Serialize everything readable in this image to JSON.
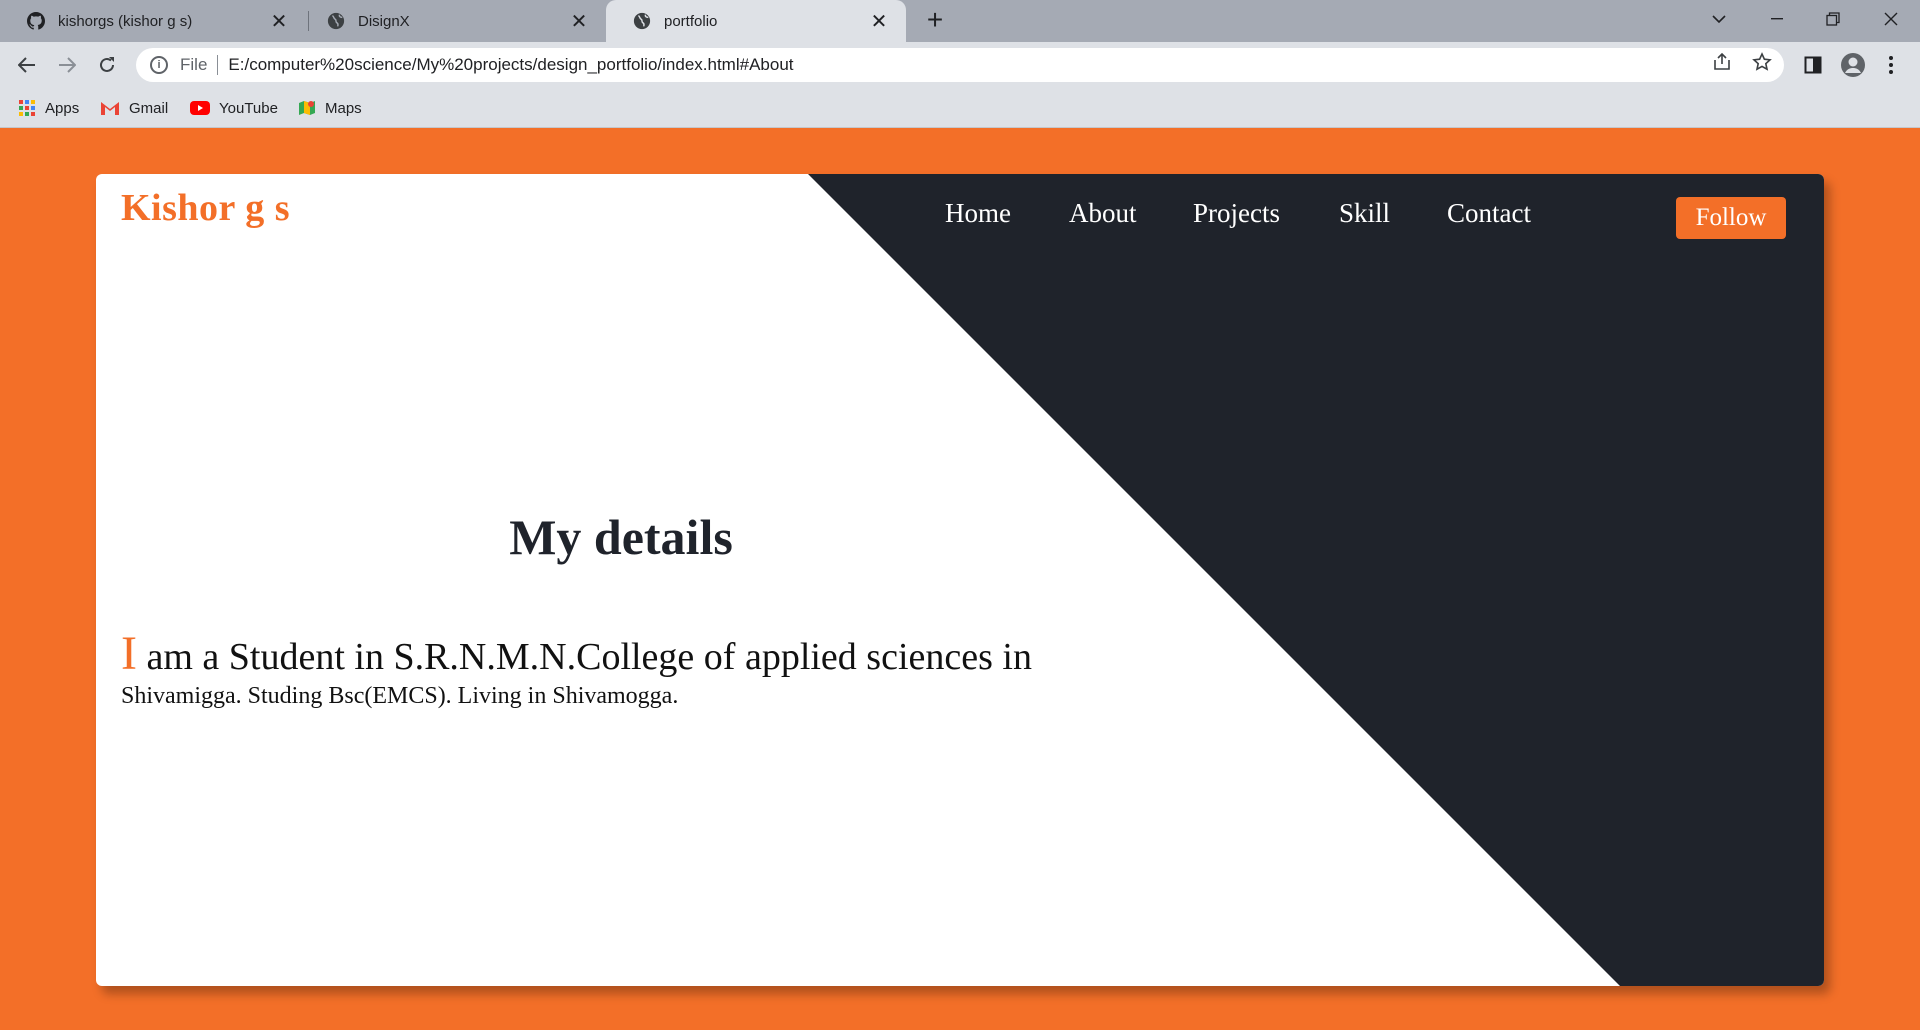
{
  "tabs": [
    {
      "title": "kishorgs (kishor g s)",
      "icon": "github-icon",
      "active": false
    },
    {
      "title": "DisignX",
      "icon": "globe-icon",
      "active": false
    },
    {
      "title": "portfolio",
      "icon": "globe-icon",
      "active": true
    }
  ],
  "address_bar": {
    "scheme_label": "File",
    "url": "E:/computer%20science/My%20projects/design_portfolio/index.html#About"
  },
  "bookmarks": [
    {
      "label": "Apps",
      "icon": "apps-grid-icon"
    },
    {
      "label": "Gmail",
      "icon": "gmail-icon"
    },
    {
      "label": "YouTube",
      "icon": "youtube-icon"
    },
    {
      "label": "Maps",
      "icon": "maps-icon"
    }
  ],
  "page": {
    "brand": "Kishor g s",
    "nav": [
      "Home",
      "About",
      "Projects",
      "Skill",
      "Contact"
    ],
    "follow_label": "Follow",
    "heading": "My details",
    "paragraph": {
      "dropcap": "I",
      "line1_rest": " am a Student in S.R.N.M.N.College of applied sciences in",
      "line2": "Shivamigga. Studing Bsc(EMCS). Living in Shivamogga."
    },
    "colors": {
      "accent": "#f36f28",
      "dark": "#1f232b",
      "page_bg": "#f36f28"
    }
  }
}
